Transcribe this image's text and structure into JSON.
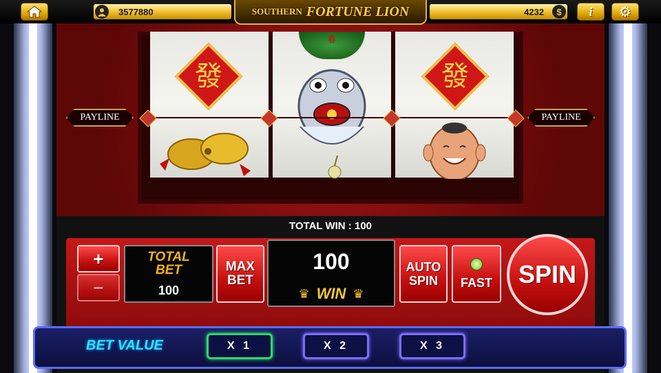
{
  "header": {
    "home_icon": "home-icon",
    "player_icon": "user-icon",
    "player_id": "3577880",
    "title_prefix": "SOUTHERN",
    "title_main": "FORTUNE LION",
    "balance": "4232",
    "coin_icon": "dollar-coin-icon",
    "info_icon": "info-icon",
    "settings_icon": "gear-icon"
  },
  "reels": {
    "payline_left": "PAYLINE",
    "payline_right": "PAYLINE",
    "symbol_text": "發",
    "top_symbol_text": "春",
    "symbols": {
      "reel1": [
        "fa-tile-symbol",
        "cymbals-symbol"
      ],
      "reel2": [
        "lion-hat-symbol",
        "lion-head-symbol",
        "lantern-symbol"
      ],
      "reel3": [
        "fa-tile-symbol",
        "laughing-buddha-symbol"
      ]
    }
  },
  "status": {
    "total_win": "TOTAL WIN : 100"
  },
  "controls": {
    "plus": "+",
    "minus": "−",
    "total_bet_label_1": "TOTAL",
    "total_bet_label_2": "BET",
    "total_bet_value": "100",
    "max_bet_1": "MAX",
    "max_bet_2": "BET",
    "win_value": "100",
    "win_label": "WIN",
    "auto_spin_1": "AUTO",
    "auto_spin_2": "SPIN",
    "fast": "FAST",
    "spin": "SPIN"
  },
  "bet_value": {
    "label": "BET VALUE",
    "options": [
      "X 1",
      "X 2",
      "X 3"
    ],
    "selected": "X 1"
  },
  "colors": {
    "gold": "#f1c232",
    "machine_red": "#c41818",
    "bet_bar_blue": "#1a1f66",
    "selected_green": "#2dd96b",
    "neon_purple": "#7b6dff"
  }
}
